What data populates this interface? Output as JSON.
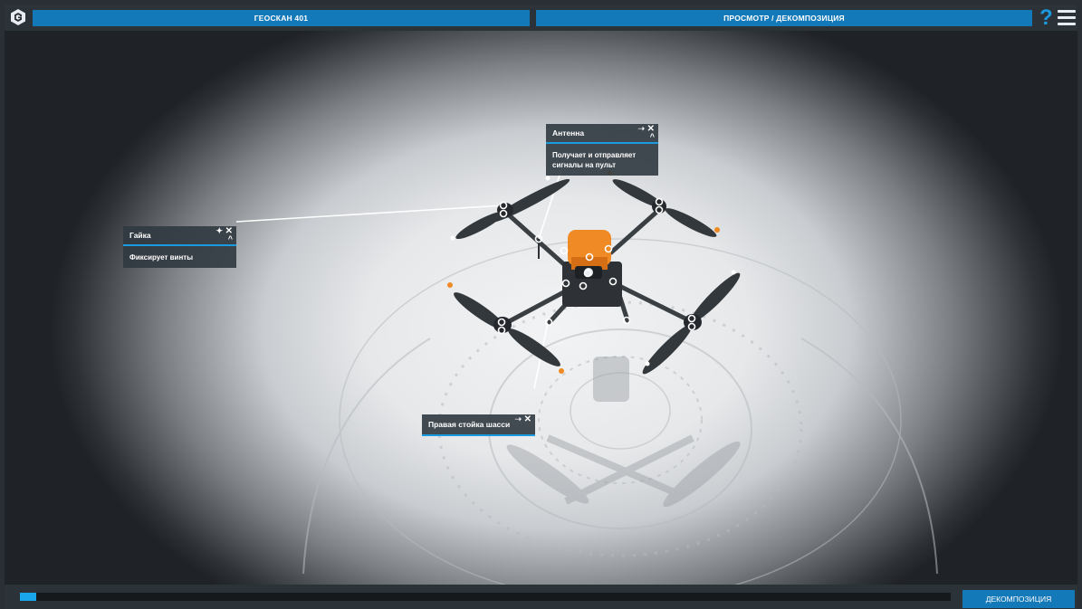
{
  "topbar": {
    "logo": "geoscan-logo-icon",
    "title_left": "ГЕОСКАН 401",
    "title_right": "ПРОСМОТР / ДЕКОМПОЗИЦИЯ",
    "help_icon": "question-mark-icon",
    "help_label": "?",
    "menu_icon": "hamburger-menu-icon"
  },
  "panels": {
    "antenna": {
      "title": "Антенна",
      "description": "Получает и отправляет сигналы на пульт"
    },
    "nut": {
      "title": "Гайка",
      "description": "Фиксирует винты"
    },
    "leg": {
      "title": "Правая стойка шасси"
    }
  },
  "controls": {
    "pin_icon": "pin-icon",
    "close_icon": "close-icon",
    "collapse_icon": "chevron-up-icon",
    "close_label": "✕",
    "collapse_label": "^"
  },
  "bottombar": {
    "progress": 0,
    "decompose_label": "ДЕКОМПОЗИЦИЯ"
  },
  "colors": {
    "accent": "#1479b8",
    "accent_bright": "#19a6ea",
    "panel_bg": "#303840",
    "drone_orange": "#f08a24"
  }
}
